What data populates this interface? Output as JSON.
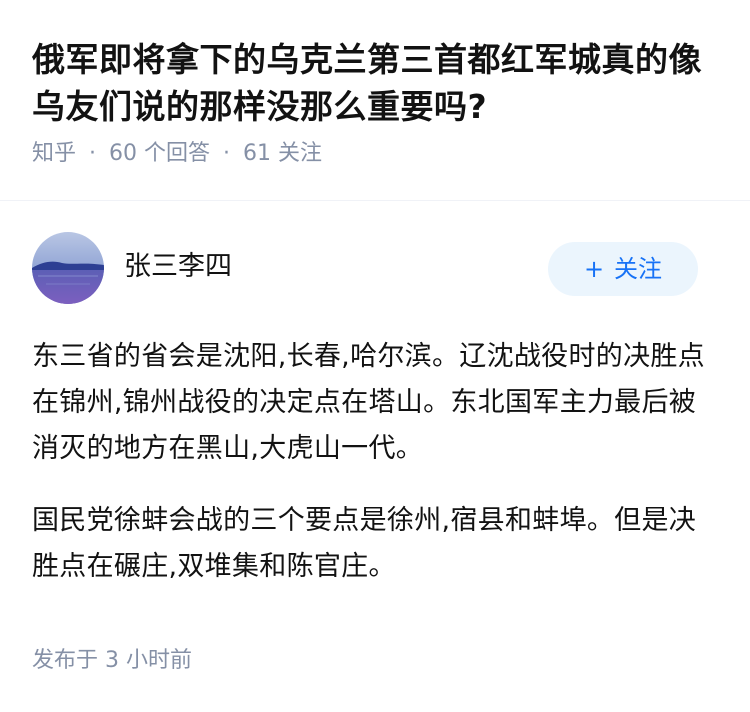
{
  "question": {
    "title": "俄军即将拿下的乌克兰第三首都红军城真的像乌友们说的那样没那么重要吗?",
    "source": "知乎",
    "answers_count": "60",
    "answers_label": "个回答",
    "followers_count": "61",
    "followers_label": "关注",
    "separator": "·"
  },
  "author": {
    "name": "张三李四",
    "avatar_icon": "lake-landscape-avatar",
    "follow_plus": "+",
    "follow_label": "关注"
  },
  "answer": {
    "paragraphs": [
      "东三省的省会是沈阳,长春,哈尔滨。辽沈战役时的决胜点在锦州,锦州战役的决定点在塔山。东北国军主力最后被消灭的地方在黑山,大虎山一代。",
      "国民党徐蚌会战的三个要点是徐州,宿县和蚌埠。但是决胜点在碾庄,双堆集和陈官庄。"
    ]
  },
  "footer": {
    "published_prefix": "发布于",
    "published_number": "3",
    "published_unit": "小时前"
  },
  "colors": {
    "text_primary": "#121212",
    "text_secondary": "#8590a6",
    "accent": "#1772f6",
    "follow_bg": "#ebf5fd",
    "divider": "#f0f2f7"
  }
}
